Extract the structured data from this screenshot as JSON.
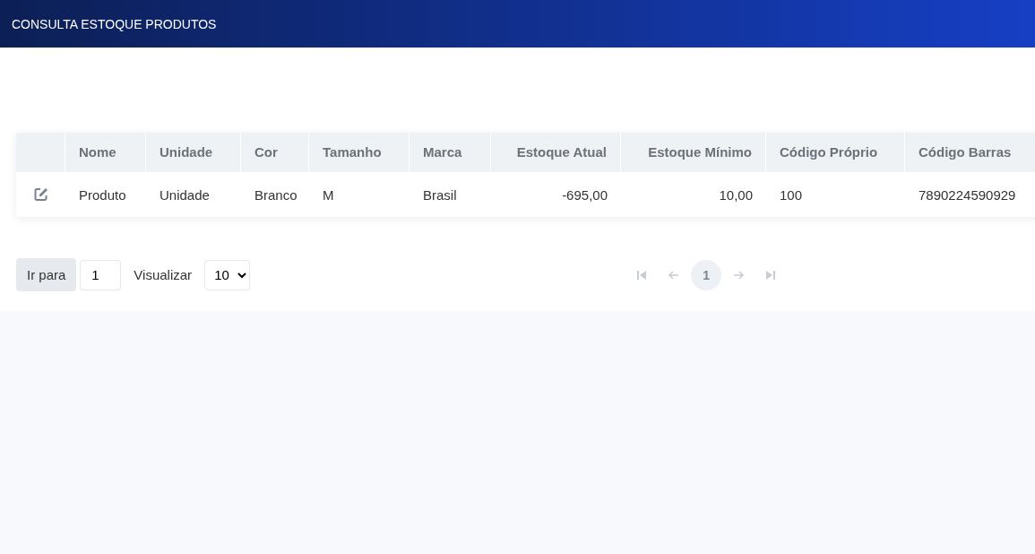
{
  "header": {
    "title": "CONSULTA ESTOQUE PRODUTOS"
  },
  "table": {
    "columns": [
      {
        "kind": "action"
      },
      {
        "label": "Nome",
        "kind": "text"
      },
      {
        "label": "Unidade",
        "kind": "text"
      },
      {
        "label": "Cor",
        "kind": "text"
      },
      {
        "label": "Tamanho",
        "kind": "text"
      },
      {
        "label": "Marca",
        "kind": "text"
      },
      {
        "label": "Estoque Atual",
        "kind": "number"
      },
      {
        "label": "Estoque Mínimo",
        "kind": "number"
      },
      {
        "label": "Código Próprio",
        "kind": "text"
      },
      {
        "label": "Código Barras",
        "kind": "text"
      }
    ],
    "rows": [
      {
        "cells": [
          "",
          "Produto",
          "Unidade",
          "Branco",
          "M",
          "Brasil",
          "-695,00",
          "10,00",
          "100",
          "7890224590929"
        ]
      }
    ]
  },
  "pagination": {
    "goto_label": "Ir para",
    "goto_value": "1",
    "view_label": "Visualizar",
    "page_size": "10",
    "nav": [
      {
        "kind": "first",
        "disabled": true
      },
      {
        "kind": "prev",
        "disabled": true
      },
      {
        "kind": "page",
        "label": "1",
        "selected": true
      },
      {
        "kind": "next",
        "disabled": true
      },
      {
        "kind": "last",
        "disabled": true
      }
    ]
  }
}
